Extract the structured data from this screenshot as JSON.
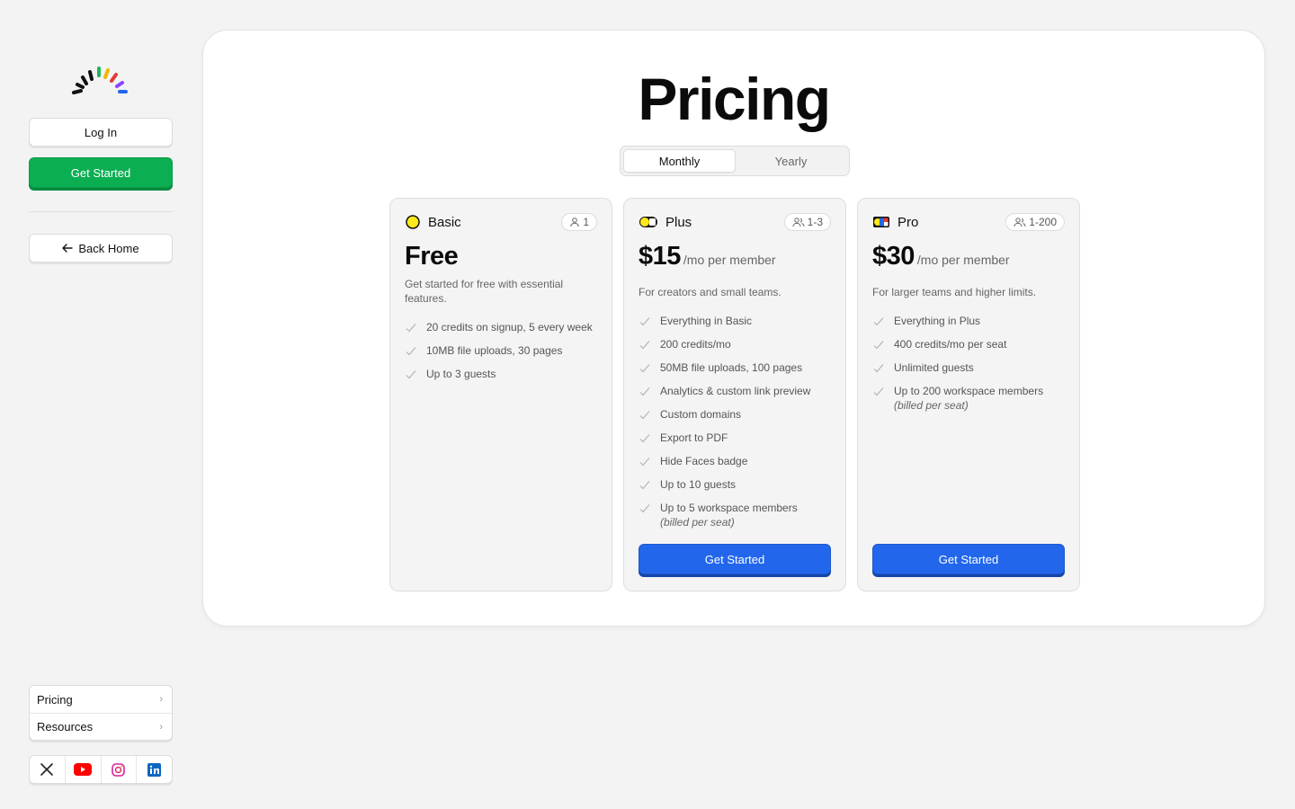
{
  "sidebar": {
    "login_label": "Log In",
    "get_started_label": "Get Started",
    "back_home_label": "Back Home",
    "nav": [
      {
        "label": "Pricing"
      },
      {
        "label": "Resources"
      }
    ],
    "social": [
      {
        "icon": "x-icon"
      },
      {
        "icon": "youtube-icon"
      },
      {
        "icon": "instagram-icon"
      },
      {
        "icon": "linkedin-icon"
      }
    ]
  },
  "main": {
    "title": "Pricing",
    "billing_toggle": {
      "options": [
        "Monthly",
        "Yearly"
      ],
      "selected": "Monthly"
    },
    "plans": [
      {
        "name": "Basic",
        "icon": "yellow-circle-icon",
        "seats": "1",
        "price": "Free",
        "description": "Get started for free with essential features.",
        "features": [
          {
            "text": "20 credits on signup, 5 every week"
          },
          {
            "text": "10MB file uploads, 30 pages"
          },
          {
            "text": "Up to 3 guests"
          }
        ]
      },
      {
        "name": "Plus",
        "icon": "yellow-black-pill-icon",
        "seats": "1-3",
        "price": "$15",
        "price_unit": "/mo per member",
        "description": "For creators and small teams.",
        "features": [
          {
            "text": "Everything in Basic"
          },
          {
            "text": "200 credits/mo"
          },
          {
            "text": "50MB file uploads, 100 pages"
          },
          {
            "text": "Analytics & custom link preview"
          },
          {
            "text": "Custom domains"
          },
          {
            "text": "Export to PDF"
          },
          {
            "text": "Hide Faces badge"
          },
          {
            "text": "Up to 10 guests"
          },
          {
            "text": "Up to 5 workspace members",
            "note": "(billed per seat)"
          }
        ],
        "cta": "Get Started"
      },
      {
        "name": "Pro",
        "icon": "multicolor-block-icon",
        "seats": "1-200",
        "price": "$30",
        "price_unit": "/mo per member",
        "description": "For larger teams and higher limits.",
        "features": [
          {
            "text": "Everything in Plus"
          },
          {
            "text": "400 credits/mo per seat"
          },
          {
            "text": "Unlimited guests"
          },
          {
            "text": "Up to 200 workspace members",
            "note": "(billed per seat)"
          }
        ],
        "cta": "Get Started"
      }
    ]
  },
  "colors": {
    "green": "#0cae52",
    "blue": "#2266ec",
    "background": "#f3f3f3"
  }
}
